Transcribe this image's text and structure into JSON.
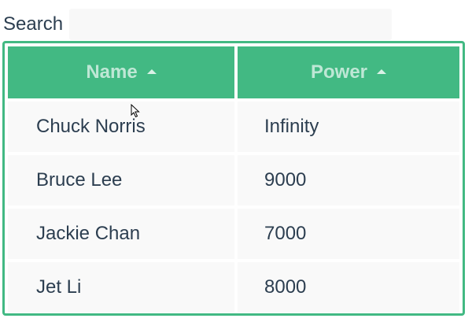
{
  "search": {
    "label": "Search",
    "value": "",
    "placeholder": ""
  },
  "grid": {
    "columns": [
      {
        "label": "Name",
        "sort": "ascending"
      },
      {
        "label": "Power",
        "sort": "ascending"
      }
    ],
    "rows": [
      {
        "name": "Chuck Norris",
        "power": "Infinity"
      },
      {
        "name": "Bruce Lee",
        "power": "9000"
      },
      {
        "name": "Jackie Chan",
        "power": "7000"
      },
      {
        "name": "Jet Li",
        "power": "8000"
      }
    ]
  },
  "colors": {
    "accent": "#42b983",
    "text": "#2c3e50",
    "cell_bg": "#f9f9f9"
  },
  "icons": {
    "sort": "sort-arrow-up-icon",
    "cursor": "mouse-pointer-icon"
  }
}
